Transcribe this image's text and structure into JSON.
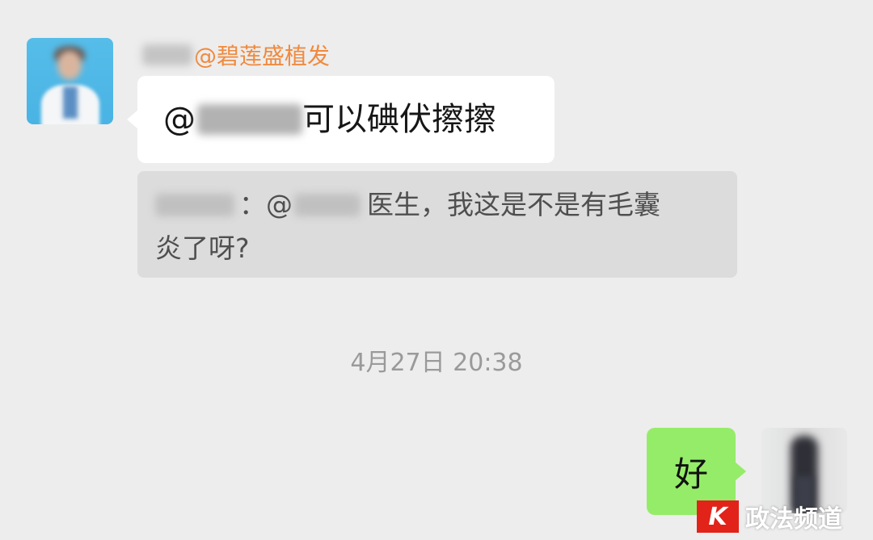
{
  "chat": {
    "sender_suffix": "@碧莲盛植发",
    "message_prefix": "@",
    "message_suffix": "可以碘伏擦擦",
    "quote": {
      "separator": "：@",
      "line1_end": " 医生，我这是不是有毛囊",
      "line2": "炎了呀?"
    },
    "timestamp": "4月27日 20:38",
    "reply": "好"
  },
  "watermark": {
    "logo": "K",
    "text": "政法频道"
  },
  "colors": {
    "background": "#ededed",
    "sender_name": "#f08a3e",
    "bubble_self": "#95ec69",
    "bubble_other": "#ffffff",
    "quote_bg": "#dcdcdc",
    "watermark_red": "#e2231a"
  }
}
